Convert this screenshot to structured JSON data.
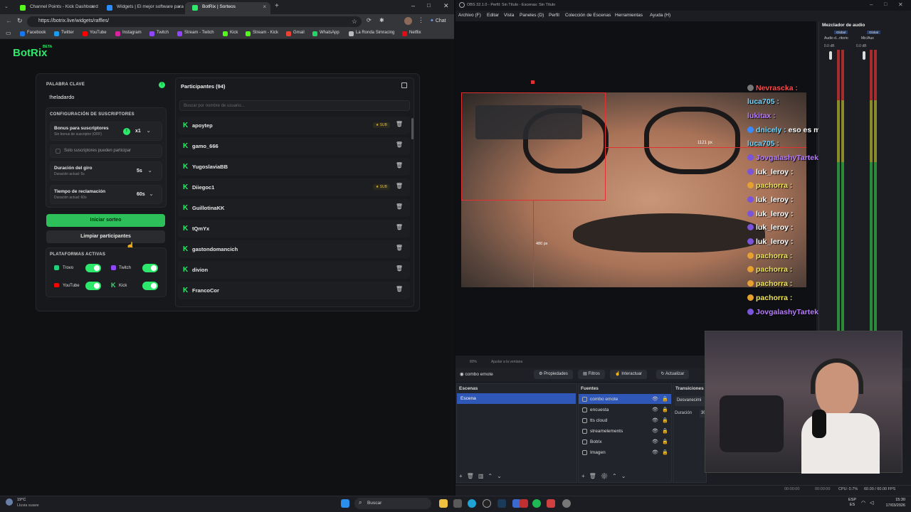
{
  "browser": {
    "tabs": [
      {
        "label": "Channel Points - Kick Dashboard",
        "color": "#53fc18"
      },
      {
        "label": "Widgets | El mejor software para",
        "color": "#2a8dff"
      },
      {
        "label": "BotRix | Sorteos",
        "color": "#2ee86b"
      }
    ],
    "url": "https://botrix.live/widgets/raffles/",
    "chat_label": "Chat",
    "bookmarks": [
      "Facebook",
      "Twitter",
      "YouTube",
      "Instagram",
      "Twitch",
      "Stream - Twitch",
      "Kick",
      "Stream - Kick",
      "Gmail",
      "WhatsApp",
      "La Ronda Simracing",
      "Netflix"
    ]
  },
  "botrix": {
    "logo": "BotRix",
    "beta": "BETA",
    "keyword_label": "PALABRA CLAVE",
    "keyword_value": "!heladardo",
    "subs_config_label": "CONFIGURACIÓN DE SUSCRIPTORES",
    "bonus_label": "Bonus para suscriptores",
    "bonus_sub": "Sin bonus de suscriptor (OFF)",
    "bonus_value": "x1",
    "subs_only_label": "Solo suscriptores pueden participar",
    "spin_label": "Duración del giro",
    "spin_sub": "Duración actual: 5s",
    "spin_value": "5s",
    "claim_label": "Tiempo de reclamación",
    "claim_sub": "Duración actual: 60s",
    "claim_value": "60s",
    "start_button": "Iniciar sorteo",
    "clear_button": "Limpiar participantes",
    "platforms_label": "PLATAFORMAS ACTIVAS",
    "platforms": [
      "Trovo",
      "Twitch",
      "YouTube",
      "Kick"
    ],
    "participants_title": "Participantes (94)",
    "search_placeholder": "Buscar por nombre de usuario...",
    "sub_badge": "SUB",
    "participants": [
      {
        "name": "apoytep",
        "sub": true
      },
      {
        "name": "gamo_666",
        "sub": false
      },
      {
        "name": "YugoslaviaBB",
        "sub": false
      },
      {
        "name": "Diiegoc1",
        "sub": true
      },
      {
        "name": "GuillotinaKK",
        "sub": false
      },
      {
        "name": "tQmYx",
        "sub": false
      },
      {
        "name": "gastondomancich",
        "sub": false
      },
      {
        "name": "divion",
        "sub": false
      },
      {
        "name": "FrancoCor",
        "sub": false
      }
    ]
  },
  "obs": {
    "title": "OBS 32.1.0 - Perfil: Sin Título - Escenas: Sin Título",
    "menu": [
      "Archivo (F)",
      "Editar",
      "Vista",
      "Paneles (D)",
      "Perfil",
      "Colección de Escenas",
      "Herramientas",
      "Ayuda (H)"
    ],
    "mixer_title": "Mezclador de audio",
    "mixer_channels": [
      "Audio d...ritorio",
      "Mic/Aux"
    ],
    "mixer_global": "Global",
    "mixer_db": "0.0 dB",
    "measure_width": "1121 px",
    "measure_height": "480 px",
    "zoom_value": "80%",
    "zoom_fit": "Ajustar a la ventana",
    "selected_source": "combo emote",
    "toolbar": [
      "Propiedades",
      "Filtros",
      "Interactuar",
      "Actualizar"
    ],
    "scenes_title": "Escenas",
    "scene": "Escena",
    "sources_title": "Fuentes",
    "sources": [
      "combo emote",
      "encuesta",
      "tts cloud",
      "streamelements",
      "Botrix",
      "Imagen"
    ],
    "transitions_title": "Transiciones",
    "transition_value": "Desvanecimi",
    "duration_label": "Duración",
    "duration_value": "30",
    "status_time1": "00:00:00",
    "status_time2": "00:00:00",
    "cpu": "CPU: 0.7%",
    "fps": "60.00 / 60.00 FPS"
  },
  "chat": [
    {
      "user": "Nevrascka",
      "color": "#ff4a4a",
      "msg": ""
    },
    {
      "user": "luca705",
      "color": "#6fd6ff",
      "msg": ""
    },
    {
      "user": "lukitax",
      "color": "#b77cff",
      "msg": ""
    },
    {
      "user": "dnicely",
      "color": "#6fd6ff",
      "msg": "eso es malardo"
    },
    {
      "user": "luca705",
      "color": "#6fd6ff",
      "msg": ""
    },
    {
      "user": "JovgalashyTartek",
      "color": "#b77cff",
      "msg": ""
    },
    {
      "user": "luk_leroy",
      "color": "#ffffff",
      "msg": ""
    },
    {
      "user": "pachorra",
      "color": "#f2e65a",
      "msg": ""
    },
    {
      "user": "luk_leroy",
      "color": "#ffffff",
      "msg": ""
    },
    {
      "user": "luk_leroy",
      "color": "#ffffff",
      "msg": ""
    },
    {
      "user": "luk_leroy",
      "color": "#ffffff",
      "msg": ""
    },
    {
      "user": "luk_leroy",
      "color": "#ffffff",
      "msg": ""
    },
    {
      "user": "pachorra",
      "color": "#f2e65a",
      "msg": ""
    },
    {
      "user": "pachorra",
      "color": "#f2e65a",
      "msg": ""
    },
    {
      "user": "pachorra",
      "color": "#f2e65a",
      "msg": ""
    },
    {
      "user": "pachorra",
      "color": "#f2e65a",
      "msg": ""
    },
    {
      "user": "JovgalashyTartek",
      "color": "#b77cff",
      "msg": ""
    }
  ],
  "taskbar": {
    "weather_temp": "19°C",
    "weather_desc": "Lluvia suave",
    "search_label": "Buscar",
    "lang": "ESP",
    "lang2": "ES",
    "time": "15:30",
    "date": "17/03/2026"
  }
}
